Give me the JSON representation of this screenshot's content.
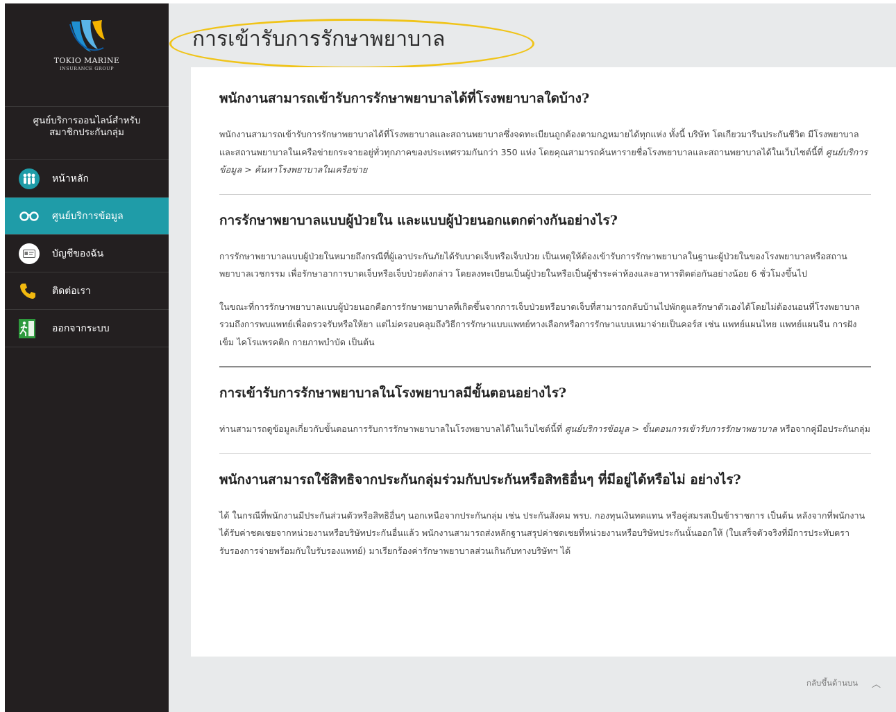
{
  "brand": {
    "name": "TOKIO MARINE",
    "group": "INSURANCE GROUP"
  },
  "sidebar": {
    "service_title_line1": "ศูนย์บริการออนไลน์สำหรับ",
    "service_title_line2": "สมาชิกประกันกลุ่ม",
    "items": [
      {
        "label": "หน้าหลัก",
        "icon": "people-icon",
        "active": false
      },
      {
        "label": "ศูนย์บริการข้อมูล",
        "icon": "glasses-icon",
        "active": true
      },
      {
        "label": "บัญชีของฉัน",
        "icon": "id-card-icon",
        "active": false
      },
      {
        "label": "ติดต่อเรา",
        "icon": "phone-icon",
        "active": false
      },
      {
        "label": "ออกจากระบบ",
        "icon": "exit-icon",
        "active": false
      }
    ]
  },
  "page": {
    "title": "การเข้ารับการรักษาพยาบาล"
  },
  "faqs": [
    {
      "question": "พนักงานสามารถเข้ารับการรักษาพยาบาลได้ที่โรงพยาบาลใดบ้าง?",
      "p1_text": "พนักงานสามารถเข้ารับการรักษาพยาบาลได้ที่โรงพยาบาลและสถานพยาบาลซึ่งจดทะเบียนถูกต้องตามกฎหมายได้ทุกแห่ง ทั้งนี้ บริษัท โตเกียวมารีนประกันชีวิต มีโรงพยาบาลและสถานพยาบาลในเครือข่ายกระจายอยู่ทั่วทุกภาคของประเทศรวมกันกว่า 350 แห่ง โดยคุณสามารถค้นหารายชื่อโรงพยาบาลและสถานพยาบาลได้ในเว็บไซต์นี้ที่ ",
      "p1_link": "ศูนย์บริการข้อมูล > ค้นหาโรงพยาบาลในเครือข่าย"
    },
    {
      "question": "การรักษาพยาบาลแบบผู้ป่วยใน และแบบผู้ป่วยนอกแตกต่างกันอย่างไร?",
      "p1_text": "การรักษาพยาบาลแบบผู้ป่วยในหมายถึงกรณีที่ผู้เอาประกันภัยได้รับบาดเจ็บหรือเจ็บป่วย เป็นเหตุให้ต้องเข้ารับการรักษาพยาบาลในฐานะผู้ป่วยในของโรงพยาบาลหรือสถานพยาบาลเวชกรรม เพื่อรักษาอาการบาดเจ็บหรือเจ็บป่วยดังกล่าว โดยลงทะเบียนเป็นผู้ป่วยในหรือเป็นผู้ชำระค่าห้องและอาหารติดต่อกันอย่างน้อย 6 ชั่วโมงขึ้นไป",
      "p2_text": "ในขณะที่การรักษาพยาบาลแบบผู้ป่วยนอกคือการรักษาพยาบาลที่เกิดขึ้นจากการเจ็บป่วยหรือบาดเจ็บที่สามารถกลับบ้านไปพักดูแลรักษาตัวเองได้โดยไม่ต้องนอนที่โรงพยาบาล รวมถึงการพบแพทย์เพื่อตรวจรับหรือให้ยา แต่ไม่ครอบคลุมถึงวิธีการรักษาแบบแพทย์ทางเลือกหรือการรักษาแบบเหมาจ่ายเป็นคอร์ส เช่น แพทย์แผนไทย แพทย์แผนจีน การฝังเข็ม ไคโรแพรคติก กายภาพบำบัด เป็นต้น"
    },
    {
      "question": "การเข้ารับการรักษาพยาบาลในโรงพยาบาลมีขั้นตอนอย่างไร?",
      "p1_text": "ท่านสามารถดูข้อมูลเกี่ยวกับขั้นตอนการรับการรักษาพยาบาลในโรงพยาบาลได้ในเว็บไซต์นี้ที่ ",
      "p1_link": "ศูนย์บริการข้อมูล > ขั้นตอนการเข้ารับการรักษาพยาบาล",
      "p1_after": " หรือจากคู่มือประกันกลุ่ม"
    },
    {
      "question": "พนักงานสามารถใช้สิทธิจากประกันกลุ่มร่วมกับประกันหรือสิทธิอื่นๆ ที่มีอยู่ได้หรือไม่ อย่างไร?",
      "p1_text": "ได้ ในกรณีที่พนักงานมีประกันส่วนตัวหรือสิทธิอื่นๆ นอกเหนือจากประกันกลุ่ม เช่น ประกันสังคม พรบ. กองทุนเงินทดแทน หรือคู่สมรสเป็นข้าราชการ เป็นต้น หลังจากที่พนักงานได้รับค่าชดเชยจากหน่วยงานหรือบริษัทประกันอื่นแล้ว พนักงานสามารถส่งหลักฐานสรุปค่าชดเชยที่หน่วยงานหรือบริษัทประกันนั้นออกให้ (ใบเสร็จตัวจริงที่มีการประทับตรารับรองการจ่ายพร้อมกับใบรับรองแพทย์) มาเรียกร้องค่ารักษาพยาบาลส่วนเกินกับทางบริษัทฯ ได้"
    }
  ],
  "footer": {
    "back_to_top": "กลับขึ้นด้านบน"
  },
  "colors": {
    "sidebar_bg": "#231f20",
    "active": "#1f9ca8",
    "highlight_oval": "#f0c419",
    "main_bg": "#e8eaeb"
  }
}
